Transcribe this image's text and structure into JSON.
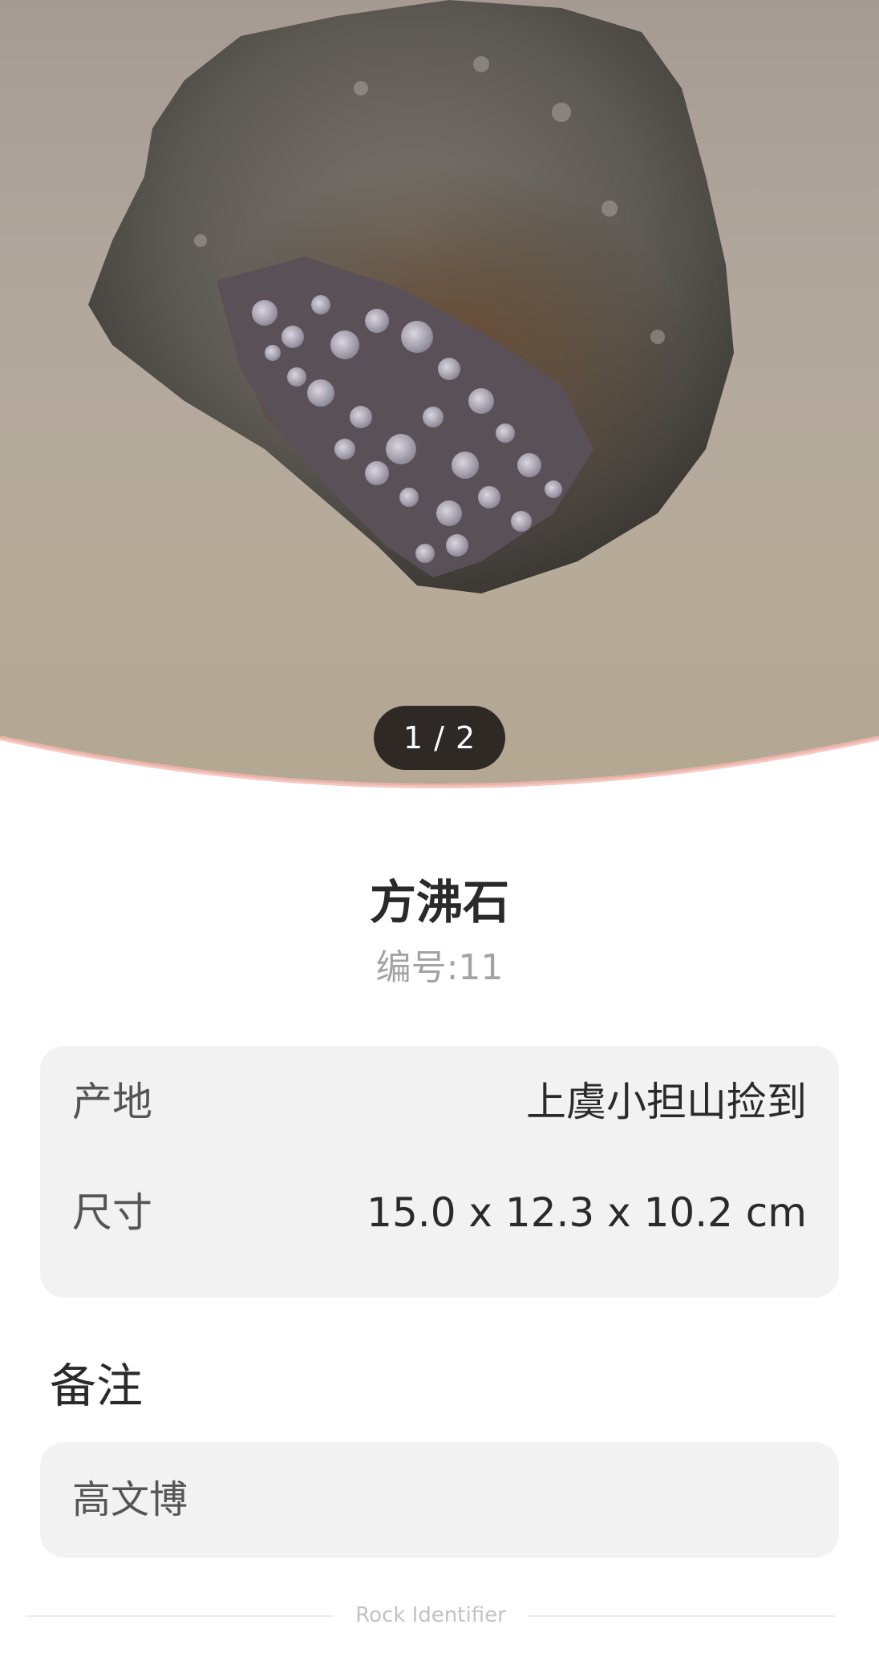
{
  "hero": {
    "counter": "1 / 2"
  },
  "specimen": {
    "name": "方沸石",
    "serial_text": "编号:11"
  },
  "details": [
    {
      "label": "产地",
      "value": "上虞小担山捡到"
    },
    {
      "label": "尺寸",
      "value": "15.0 x 12.3 x 10.2 cm"
    }
  ],
  "notes": {
    "heading": "备注",
    "text": "高文博"
  },
  "footer": {
    "brand": "Rock Identifier"
  },
  "colors": {
    "card_bg": "#f2f2f2",
    "counter_bg": "#2f2925",
    "accent_curve": "#f5b8b0"
  }
}
